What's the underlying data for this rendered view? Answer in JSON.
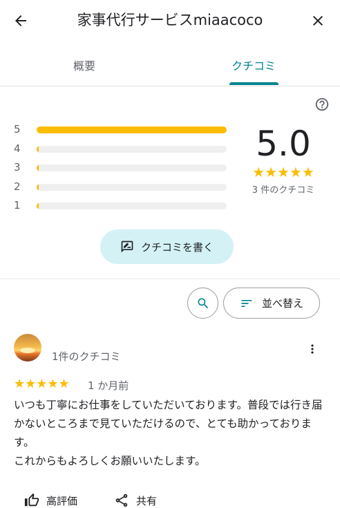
{
  "header": {
    "title": "家事代行サービスmiaacoco",
    "back_icon": "arrow-back-icon",
    "close_icon": "close-icon"
  },
  "tabs": [
    {
      "label": "概要",
      "active": false
    },
    {
      "label": "クチコミ",
      "active": true
    }
  ],
  "colors": {
    "accent": "#00838f",
    "star": "#fbbc04",
    "write_button_bg": "#d4f2f6"
  },
  "summary": {
    "average": "5.0",
    "stars": "★★★★★",
    "count_label": "3 件のクチコミ",
    "distribution": [
      {
        "label": "5",
        "fraction": 1.0
      },
      {
        "label": "4",
        "fraction": 0.0
      },
      {
        "label": "3",
        "fraction": 0.0
      },
      {
        "label": "2",
        "fraction": 0.0
      },
      {
        "label": "1",
        "fraction": 0.0
      }
    ]
  },
  "actions": {
    "write_review_label": "クチコミを書く",
    "sort_label": "並べ替え"
  },
  "reviews": [
    {
      "reviewer_name": "",
      "reviewer_review_count": "1件のクチコミ",
      "stars": "★★★★★",
      "date": "1 か月前",
      "text": "いつも丁寧にお仕事をしていただいております。普段では行き届かないところまで見ていただけるので、とても助かっております。\nこれからもよろしくお願いいたします。",
      "like_label": "高評価",
      "share_label": "共有"
    }
  ]
}
